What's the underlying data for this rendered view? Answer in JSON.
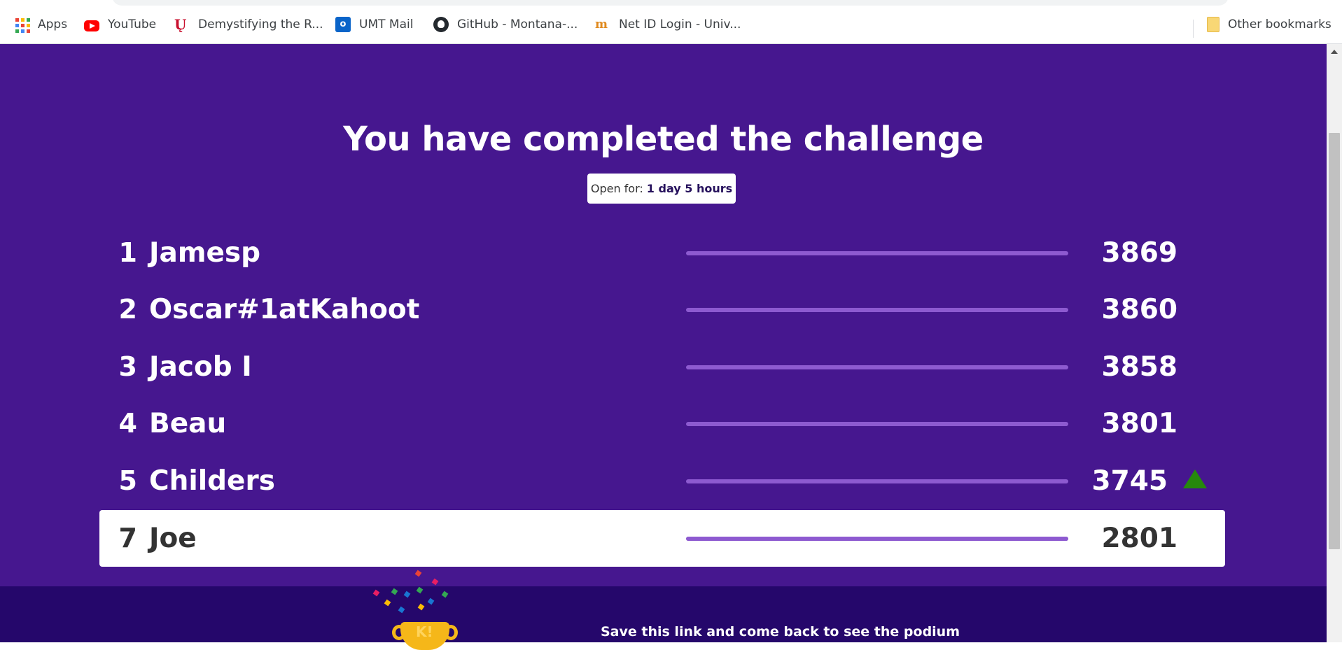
{
  "bookmarks": [
    {
      "label": "Apps",
      "icon": "apps-icon"
    },
    {
      "label": "YouTube",
      "icon": "youtube-icon"
    },
    {
      "label": "Demystifying the R...",
      "icon": "uq-icon"
    },
    {
      "label": "UMT Mail",
      "icon": "outlook-icon"
    },
    {
      "label": "GitHub - Montana-...",
      "icon": "github-icon"
    },
    {
      "label": "Net ID Login - Univ...",
      "icon": "netid-icon"
    },
    {
      "label": "Other bookmarks",
      "icon": "folder-icon"
    }
  ],
  "challenge": {
    "title": "You have completed the challenge",
    "open_for_label": "Open for:",
    "open_for_value": "1 day 5 hours"
  },
  "leaderboard": [
    {
      "rank": "1",
      "name": "Jamesp",
      "score": "3869",
      "progress": 1.0
    },
    {
      "rank": "2",
      "name": "Oscar#1atKahoot",
      "score": "3860",
      "progress": 1.0
    },
    {
      "rank": "3",
      "name": "Jacob I",
      "score": "3858",
      "progress": 1.0
    },
    {
      "rank": "4",
      "name": "Beau",
      "score": "3801",
      "progress": 1.0
    },
    {
      "rank": "5",
      "name": "Childers",
      "score": "3745",
      "progress": 1.0,
      "trend": "up"
    },
    {
      "rank": "7",
      "name": "Joe",
      "score": "2801",
      "progress": 1.0,
      "current_player": true
    }
  ],
  "footer": {
    "message": "Save this link and come back to see the podium",
    "trophy_letters": "K!"
  },
  "colors": {
    "background": "#46178f",
    "footer": "#25076b",
    "progress": "#8d5ad0",
    "trend_up": "#26890c"
  }
}
